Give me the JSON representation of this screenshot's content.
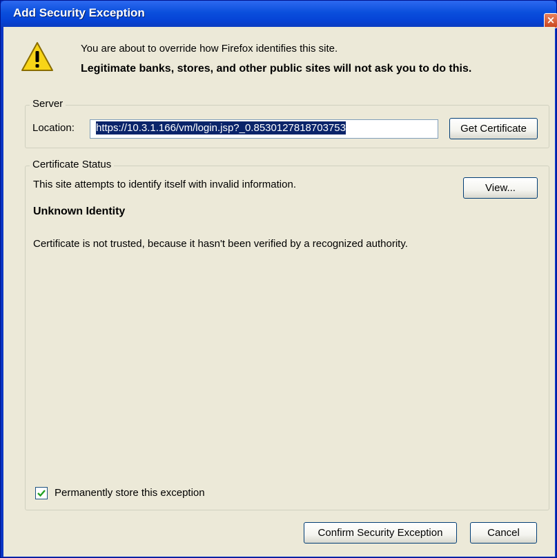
{
  "window": {
    "title": "Add Security Exception",
    "close_glyph": "×",
    "accent_color": "#0a4fdc",
    "icons": [
      "warning-icon",
      "close-icon",
      "checkmark-icon"
    ]
  },
  "intro": {
    "line1": "You are about to override how Firefox identifies this site.",
    "line2": "Legitimate banks, stores, and other public sites will not ask you to do this."
  },
  "server": {
    "legend": "Server",
    "location_label": "Location:",
    "location_value": "https://10.3.1.166/vm/login.jsp?_0.8530127818703753",
    "get_certificate_label": "Get Certificate"
  },
  "certificate_status": {
    "legend": "Certificate Status",
    "description": "This site attempts to identify itself with invalid information.",
    "view_label": "View...",
    "identity_heading": "Unknown Identity",
    "detail": "Certificate is not trusted, because it hasn't been verified by a recognized authority."
  },
  "options": {
    "permanent_label": "Permanently store this exception",
    "permanent_checked": true
  },
  "actions": {
    "confirm_label": "Confirm Security Exception",
    "cancel_label": "Cancel"
  }
}
